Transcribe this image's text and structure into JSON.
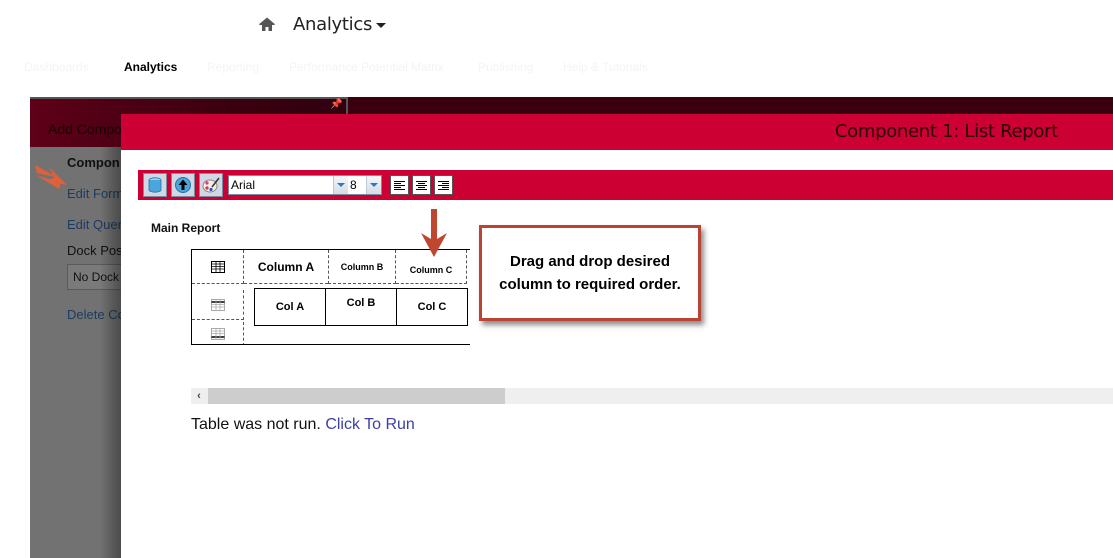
{
  "header": {
    "home_icon": "home-icon",
    "app_title": "Analytics"
  },
  "nav": {
    "items": [
      {
        "label": "Dashboards",
        "active": false
      },
      {
        "label": "Analytics",
        "active": true
      },
      {
        "label": "Reporting",
        "active": false
      },
      {
        "label": "Performance Potential Matrix",
        "active": false
      },
      {
        "label": "Publishing",
        "active": false
      },
      {
        "label": "Help & Tutorials",
        "active": false
      }
    ]
  },
  "left_panel": {
    "title": "Add Compo",
    "section_heading": "Compon",
    "edit_format": "Edit Form",
    "edit_query": "Edit Quer",
    "dock_position_label": "Dock Pos",
    "dock_position_value": "No Dock",
    "delete": "Delete Co"
  },
  "modal": {
    "title": "Component 1: List Report",
    "toolbar": {
      "font_name": "Arial",
      "font_size": "8",
      "buttons": [
        "database-icon",
        "upload-icon",
        "palette-icon",
        "align-left-icon",
        "align-center-icon",
        "align-right-icon"
      ]
    },
    "main_report_label": "Main Report",
    "header_columns": [
      "Column A",
      "Column B",
      "Column C"
    ],
    "data_columns": [
      "Col A",
      "Col B",
      "Col C"
    ],
    "callout_text": "Drag and drop desired column to required order.",
    "status_text": "Table was not run.",
    "run_link": "Click To Run"
  },
  "colors": {
    "brand_red": "#cc0033",
    "dark_header": "#3a0010",
    "callout_border": "#b94434",
    "link_blue": "#3b3fa8"
  }
}
